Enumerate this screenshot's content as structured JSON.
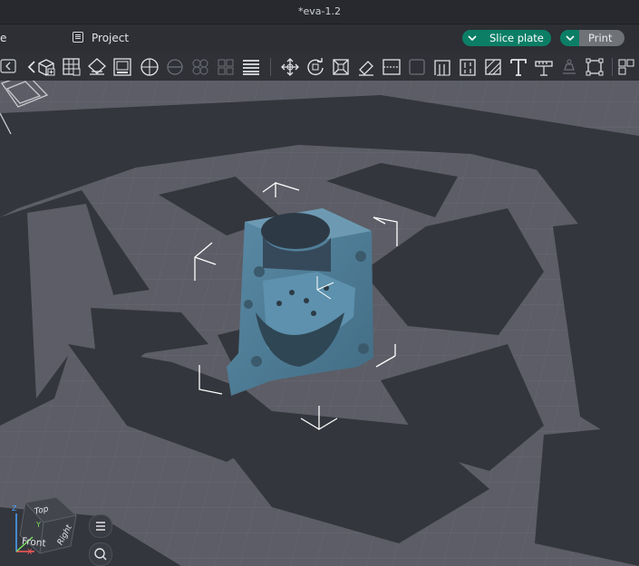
{
  "window": {
    "title": "*eva-1.2"
  },
  "menubar": {
    "left_partial": "e",
    "project_label": "Project"
  },
  "actions": {
    "slice_label": "Slice plate",
    "print_label": "Print",
    "slice_color": "#0c7e66",
    "print_color": "#6f7277"
  },
  "toolbar": {
    "icons": [
      "collapse-icon",
      "back-icon",
      "add-cube-icon",
      "arrange-icon",
      "orient-icon",
      "plate-icon",
      "add-part-icon",
      "split-icon",
      "split-parts-icon",
      "variable-layer-icon",
      "layers-icon",
      "move-icon",
      "rotate-icon",
      "scale-icon",
      "paint-icon",
      "cut-icon",
      "emboss-icon",
      "seam-icon",
      "support-paint-icon",
      "fuzzy-icon",
      "text-icon",
      "measure-icon",
      "assembly-icon",
      "settings-icon"
    ]
  },
  "viewcube": {
    "top": "Top",
    "front": "Front",
    "right": "Right",
    "z": "Z",
    "y": "Y",
    "x": "X"
  },
  "colors": {
    "model": "#4e7d97",
    "plate": "#5c5d66",
    "shadow": "#33353c",
    "accent": "#0c7e66"
  }
}
